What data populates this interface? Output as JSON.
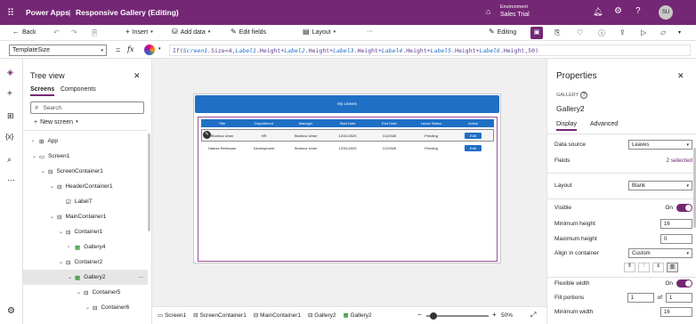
{
  "topbar": {
    "app": "Power Apps",
    "separator": "|",
    "title": "Responsive Gallery (Editing)",
    "env_label": "Environment",
    "env_name": "Sales Trial",
    "avatar": "SU"
  },
  "toolbar": {
    "back": "Back",
    "insert": "Insert",
    "add_data": "Add data",
    "edit_fields": "Edit fields",
    "layout": "Layout",
    "editing": "Editing"
  },
  "formula": {
    "property": "TemplateSize",
    "equals": "=",
    "fx": "fx",
    "expr_parts": [
      "If(",
      "Screen1",
      ".Size<4,",
      "Label1",
      ".Height+",
      "Label2",
      ".Height+",
      "Label3",
      ".Height+",
      "Label4",
      ".Height+",
      "Label5",
      ".Height+",
      "Label6",
      ".Height,50)"
    ]
  },
  "tree": {
    "title": "Tree view",
    "tab_screens": "Screens",
    "tab_components": "Components",
    "search_placeholder": "Search",
    "new_screen": "New screen",
    "items": [
      {
        "label": "App"
      },
      {
        "label": "Screen1"
      },
      {
        "label": "ScreenContainer1"
      },
      {
        "label": "HeaderContainer1"
      },
      {
        "label": "Label7"
      },
      {
        "label": "MainContainer1"
      },
      {
        "label": "Container1"
      },
      {
        "label": "Gallery4"
      },
      {
        "label": "Container2"
      },
      {
        "label": "Gallery2"
      },
      {
        "label": "Container5"
      },
      {
        "label": "Container6"
      }
    ]
  },
  "app_preview": {
    "header": "My Leaves",
    "columns": [
      "Title",
      "Department",
      "Manager",
      "Start Date",
      "End Date",
      "Leave Status",
      "Action"
    ],
    "rows": [
      [
        "Shahroz Umer",
        "HR",
        "Shahroz Umer",
        "12/31/2025",
        "1/1/2026",
        "Pending",
        "Edit"
      ],
      [
        "Hamza Rehmaan",
        "Development",
        "Shahroz Umer",
        "12/31/2025",
        "1/1/2026",
        "Pending",
        "Edit"
      ]
    ]
  },
  "bottom": {
    "crumbs": [
      "Screen1",
      "ScreenContainer1",
      "MainContainer1",
      "Gallery2",
      "Gallery2"
    ],
    "minus": "−",
    "plus": "+",
    "zoom": "50%"
  },
  "props": {
    "title": "Properties",
    "type": "GALLERY",
    "name": "Gallery2",
    "tab_display": "Display",
    "tab_advanced": "Advanced",
    "data_source_label": "Data source",
    "data_source": "Leaves",
    "fields_label": "Fields",
    "fields_value": "2 selected",
    "layout_label": "Layout",
    "layout_value": "Blank",
    "visible_label": "Visible",
    "visible_value": "On",
    "min_height_label": "Minimum height",
    "min_height": "16",
    "max_height_label": "Maximum height",
    "max_height": "0",
    "align_label": "Align in container",
    "align_value": "Custom",
    "flex_width_label": "Flexible width",
    "flex_width_value": "On",
    "fill_label": "Fill portions",
    "fill_value": "1",
    "fill_of": "of",
    "fill_total": "1",
    "min_width_label": "Minimum width",
    "min_width": "16"
  }
}
